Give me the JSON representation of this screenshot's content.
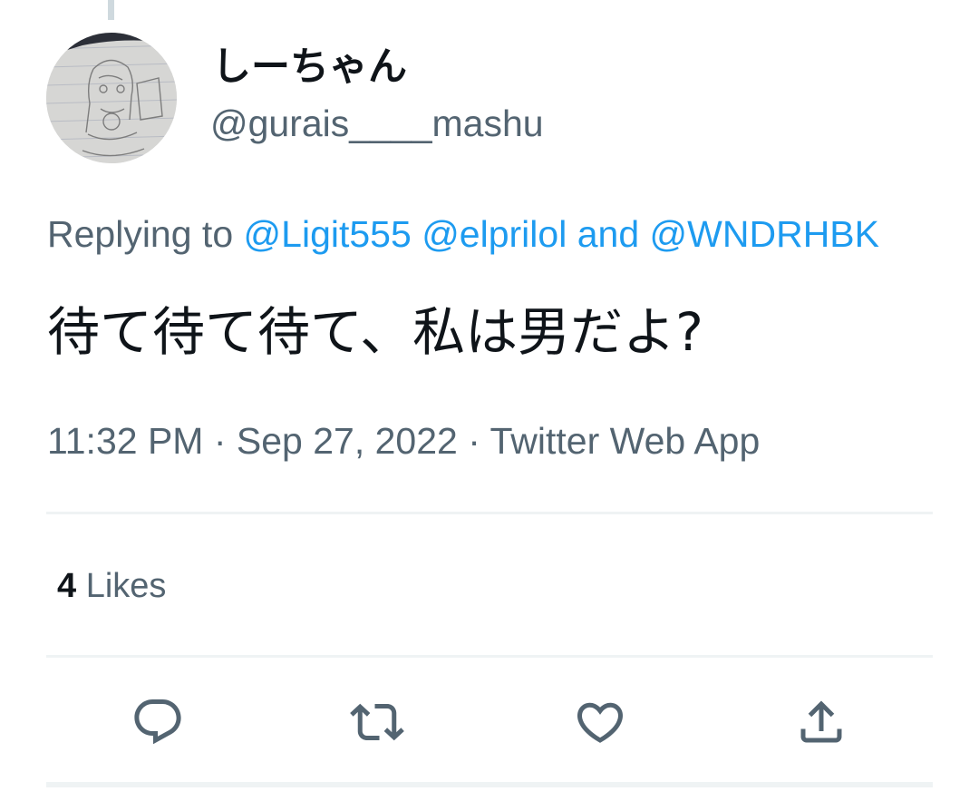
{
  "tweet": {
    "author": {
      "display_name": "しーちゃん",
      "handle": "@gurais____mashu"
    },
    "replying_to": {
      "prefix": "Replying to",
      "mentions": [
        "@Ligit555",
        "@elprilol",
        "@WNDRHBK"
      ],
      "conjunction": "and"
    },
    "text": "待て待て待て、私は男だよ?",
    "meta": "11:32 PM · Sep 27, 2022 · Twitter Web App",
    "likes": {
      "count": "4",
      "label": "Likes"
    },
    "actions": [
      {
        "name": "reply",
        "icon": "reply-icon"
      },
      {
        "name": "retweet",
        "icon": "retweet-icon"
      },
      {
        "name": "like",
        "icon": "heart-icon"
      },
      {
        "name": "share",
        "icon": "share-icon"
      }
    ]
  },
  "colors": {
    "text_primary": "#0f1419",
    "text_secondary": "#536471",
    "link": "#1d9bf0",
    "divider": "#eff3f4",
    "thread_line": "#cfd9de"
  }
}
